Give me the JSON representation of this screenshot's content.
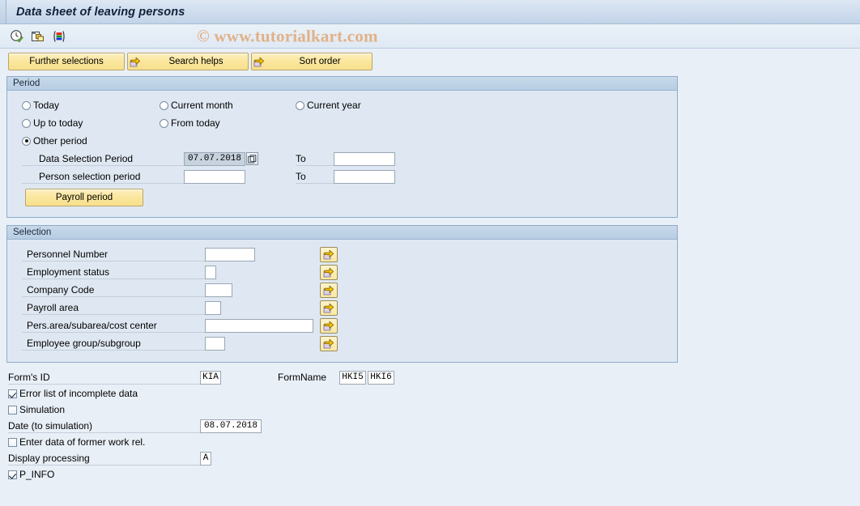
{
  "window": {
    "title": "Data sheet of leaving persons"
  },
  "toolbar": {
    "icons": [
      {
        "name": "execute-clock-icon",
        "title": "Execute"
      },
      {
        "name": "copy-multiple-icon",
        "title": "Get Variant"
      },
      {
        "name": "layout-variant-icon",
        "title": "Layout"
      }
    ],
    "watermark": "© www.tutorialkart.com"
  },
  "buttons": {
    "further_selections": "Further selections",
    "search_helps": "Search helps",
    "sort_order": "Sort order"
  },
  "period": {
    "title": "Period",
    "radios": [
      {
        "label": "Today",
        "selected": false
      },
      {
        "label": "Current month",
        "selected": false
      },
      {
        "label": "Current year",
        "selected": false
      },
      {
        "label": "Up to today",
        "selected": false
      },
      {
        "label": "From today",
        "selected": false
      },
      {
        "label": "Other period",
        "selected": true
      }
    ],
    "data_selection_period": {
      "label": "Data Selection Period",
      "value": "07.07.2018",
      "to_label": "To",
      "to_value": ""
    },
    "person_selection_period": {
      "label": "Person selection period",
      "value": "",
      "to_label": "To",
      "to_value": ""
    },
    "payroll_period_button": "Payroll period"
  },
  "selection": {
    "title": "Selection",
    "rows": [
      {
        "label": "Personnel Number",
        "value": "",
        "input_width": 62
      },
      {
        "label": "Employment status",
        "value": "",
        "input_width": 14
      },
      {
        "label": "Company Code",
        "value": "",
        "input_width": 34
      },
      {
        "label": "Payroll area",
        "value": "",
        "input_width": 20
      },
      {
        "label": "Pers.area/subarea/cost center",
        "value": "",
        "input_width": 134
      },
      {
        "label": "Employee group/subgroup",
        "value": "",
        "input_width": 25
      }
    ]
  },
  "form": {
    "form_id_label": "Form's ID",
    "form_id_value": "KIA",
    "form_name_label": "FormName",
    "form_name_value_1": "HKI5",
    "form_name_value_2": "HKI6",
    "error_list_label": "Error list of incomplete data",
    "error_list_checked": true,
    "simulation_label": "Simulation",
    "simulation_checked": false,
    "date_simulation_label": "Date (to simulation)",
    "date_simulation_value": "08.07.2018",
    "former_work_label": "Enter data of former work rel.",
    "former_work_checked": false,
    "display_processing_label": "Display processing",
    "display_processing_value": "A",
    "p_info_label": "P_INFO",
    "p_info_checked": true
  },
  "colors": {
    "background": "#e9eff7",
    "panel_bg": "#dfe8f2",
    "panel_border": "#8fabc9",
    "button_yellow": "#fae79f",
    "watermark": "#e2b187",
    "title_text": "#11223a"
  }
}
